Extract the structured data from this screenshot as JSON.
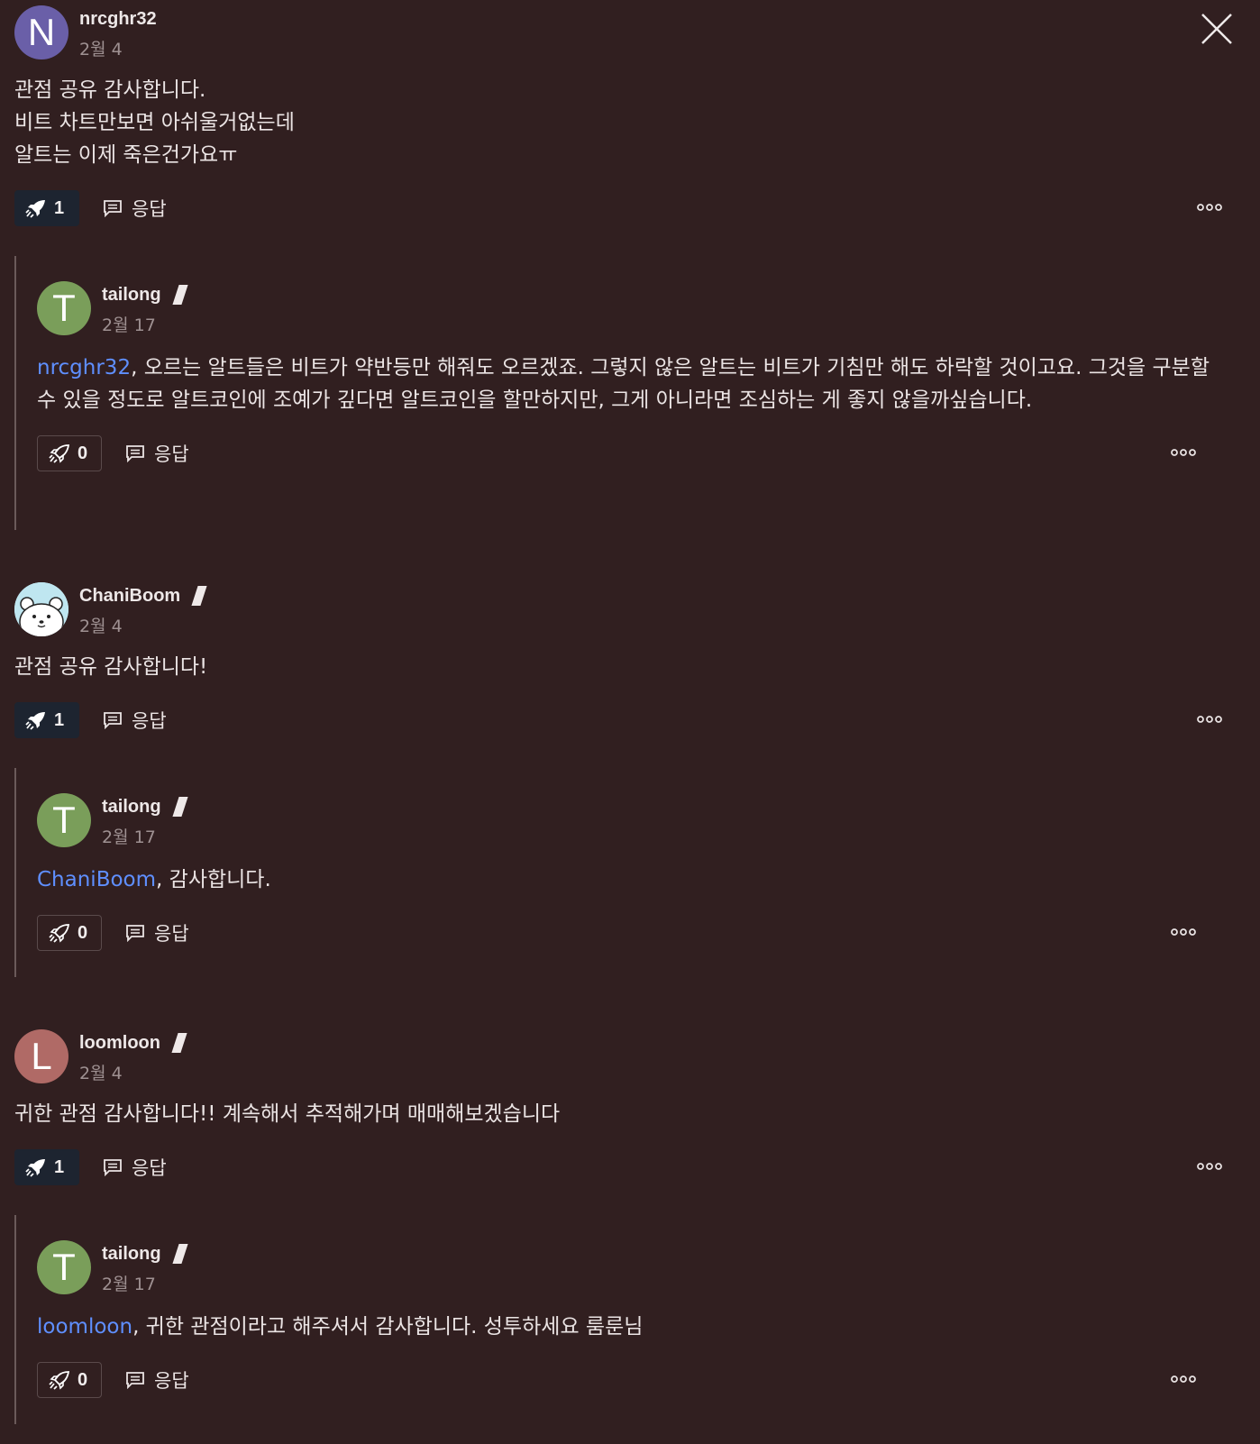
{
  "reply_label": "응답",
  "comments": [
    {
      "user": "nrcghr32",
      "avatar_letter": "N",
      "avatar_color": "#6a5fa8",
      "date": "2월 4",
      "text": "관점 공유 감사합니다.\n비트 차트만보면 아쉬울거없는데\n알트는 이제 죽은건가요ㅠ",
      "likes": "1",
      "reply": {
        "user": "tailong",
        "avatar_letter": "T",
        "avatar_color": "#7a9e5a",
        "date": "2월 17",
        "mention": "nrcghr32",
        "text": ", 오르는 알트들은 비트가 약반등만 해줘도 오르겠죠. 그렇지 않은 알트는 비트가 기침만 해도 하락할 것이고요. 그것을 구분할 수 있을 정도로 알트코인에 조예가 깊다면 알트코인을 할만하지만, 그게 아니라면 조심하는 게 좋지 않을까싶습니다.",
        "likes": "0"
      }
    },
    {
      "user": "ChaniBoom",
      "avatar_letter": "",
      "avatar_color": "#bfe6f0",
      "date": "2월 4",
      "text": "관점 공유 감사합니다!",
      "likes": "1",
      "reply": {
        "user": "tailong",
        "avatar_letter": "T",
        "avatar_color": "#7a9e5a",
        "date": "2월 17",
        "mention": "ChaniBoom",
        "text": ", 감사합니다.",
        "likes": "0"
      }
    },
    {
      "user": "loomloon",
      "avatar_letter": "L",
      "avatar_color": "#b06a66",
      "date": "2월 4",
      "text": "귀한 관점 감사합니다!! 계속해서 추적해가며 매매해보겠습니다",
      "likes": "1",
      "reply": {
        "user": "tailong",
        "avatar_letter": "T",
        "avatar_color": "#7a9e5a",
        "date": "2월 17",
        "mention": "loomloon",
        "text": ", 귀한 관점이라고 해주셔서 감사합니다. 성투하세요 룸룬님",
        "likes": "0"
      }
    }
  ]
}
